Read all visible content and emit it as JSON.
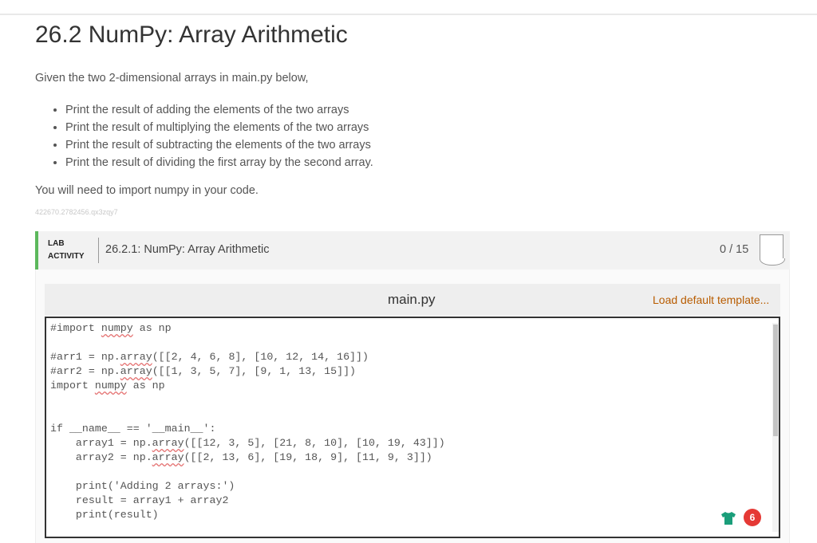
{
  "page": {
    "title": "26.2 NumPy: Array Arithmetic",
    "intro": "Given the two 2-dimensional arrays in main.py below,",
    "bullets": [
      "Print the result of adding the elements of the two arrays",
      "Print the result of multiplying the elements of the two arrays",
      "Print the result of subtracting the elements of the two arrays",
      "Print the result of dividing the first array by the second array."
    ],
    "note": "You will need to import numpy in your code.",
    "hash_id": "422670.2782456.qx3zqy7"
  },
  "lab": {
    "tag_line1": "LAB",
    "tag_line2": "ACTIVITY",
    "title": "26.2.1: NumPy: Array Arithmetic",
    "score": "0 / 15",
    "accent_color": "#5cb85c"
  },
  "editor": {
    "file_name": "main.py",
    "load_template_label": "Load default template...",
    "code_lines": [
      "#import numpy as np",
      "",
      "#arr1 = np.array([[2, 4, 6, 8], [10, 12, 14, 16]])",
      "#arr2 = np.array([[1, 3, 5, 7], [9, 1, 13, 15]])",
      "import numpy as np",
      "",
      "",
      "if __name__ == '__main__':",
      "    array1 = np.array([[12, 3, 5], [21, 8, 10], [10, 19, 43]])",
      "    array2 = np.array([[2, 13, 6], [19, 18, 9], [11, 9, 3]])",
      "",
      "    print('Adding 2 arrays:')",
      "    result = array1 + array2",
      "    print(result)"
    ]
  },
  "status": {
    "icon": "shirt-icon",
    "count": "6",
    "icon_color": "#1a9e7a",
    "badge_color": "#e53935"
  }
}
